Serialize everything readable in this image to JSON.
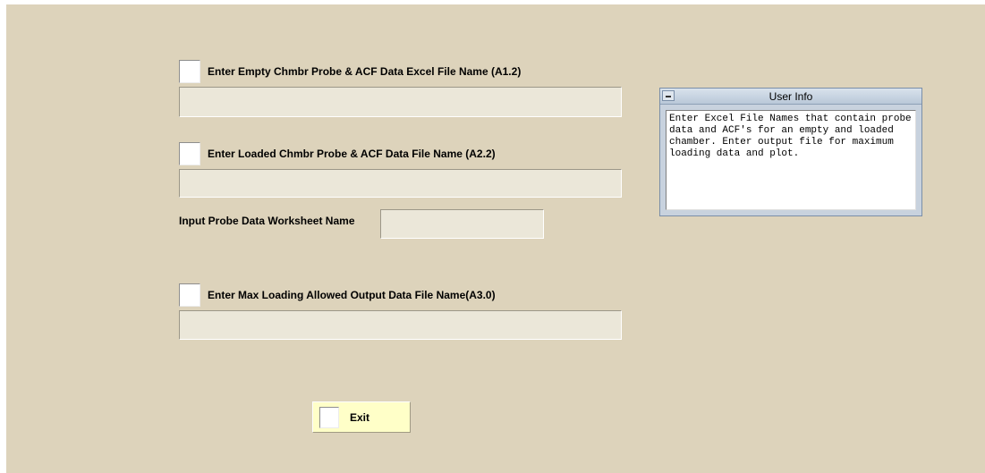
{
  "steps": [
    {
      "label": "Enter Empty Chmbr Probe & ACF Data Excel File Name (A1.2)",
      "value": ""
    },
    {
      "label": "Enter Loaded Chmbr Probe & ACF Data File Name (A2.2)",
      "value": ""
    },
    {
      "label": "Enter Max Loading Allowed Output Data File Name(A3.0)",
      "value": ""
    }
  ],
  "worksheet": {
    "label": "Input Probe Data Worksheet Name",
    "value": ""
  },
  "user_info": {
    "title": "User Info",
    "text": "Enter Excel File Names that contain probe data and ACF's for an empty and loaded chamber. Enter output file for maximum loading data and plot."
  },
  "exit_button": {
    "label": "Exit"
  },
  "colors": {
    "panel_background": "#ddd3bb",
    "field_background": "#ebe7d9",
    "exit_button_background": "#ffffc8",
    "info_title_background": "#c8d2de"
  }
}
